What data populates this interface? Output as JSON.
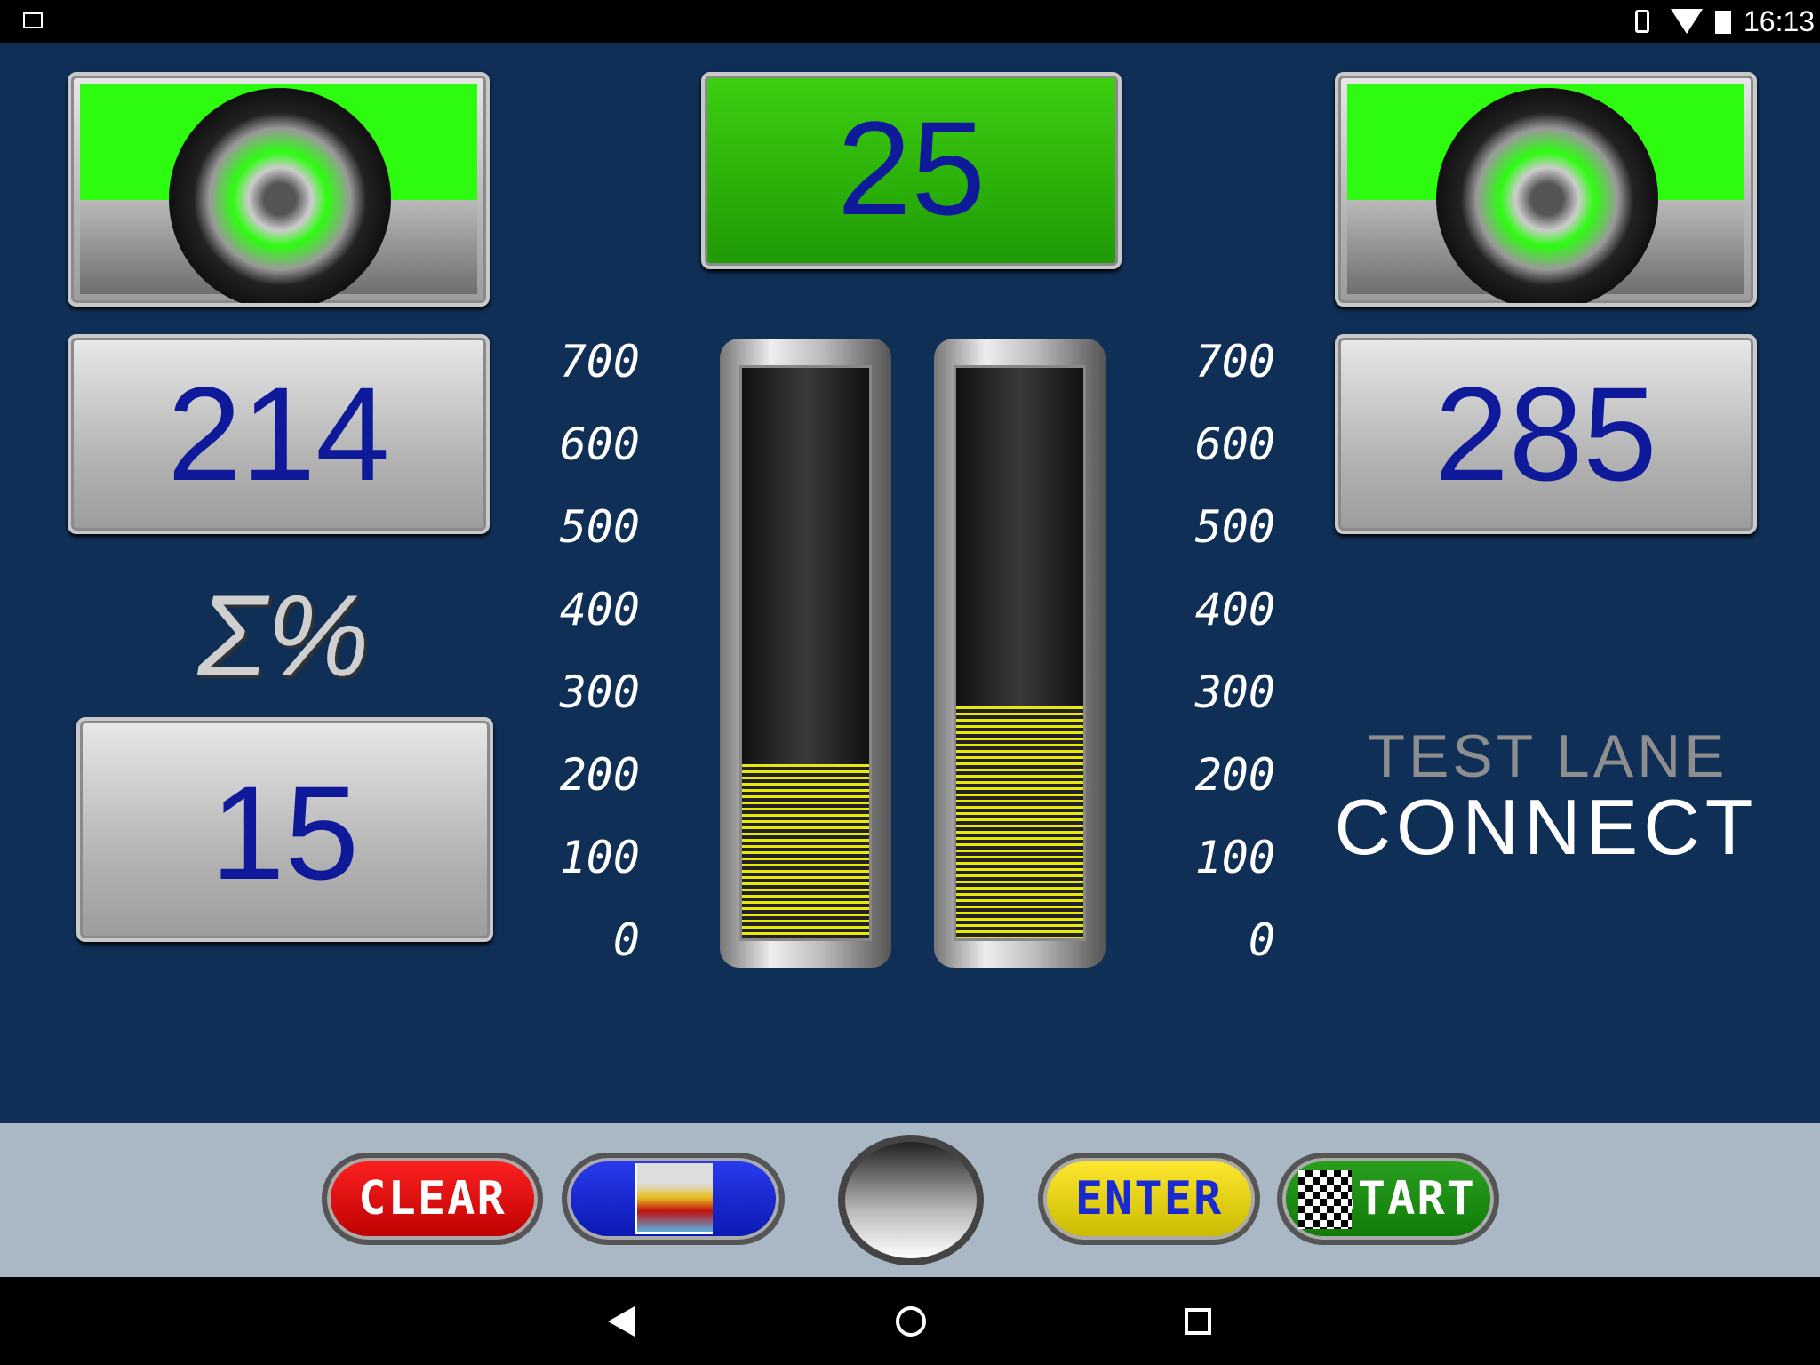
{
  "status_bar": {
    "time": "16:13",
    "icons": [
      "image-icon",
      "vibrate-icon",
      "wifi-icon",
      "battery-icon"
    ]
  },
  "center": {
    "value": "25"
  },
  "left": {
    "value": "214",
    "bar_value": 214
  },
  "right": {
    "value": "285",
    "bar_value": 285
  },
  "sum": {
    "symbol": "Σ%",
    "value": "15"
  },
  "scale": {
    "ticks": [
      "700",
      "600",
      "500",
      "400",
      "300",
      "200",
      "100",
      "0"
    ],
    "max": 700
  },
  "logo": {
    "line1": "TEST LANE",
    "line2": "CONNECT"
  },
  "buttons": {
    "clear": "CLEAR",
    "chart": "chart-icon",
    "enter": "ENTER",
    "start": "START"
  },
  "colors": {
    "background": "#0f2f56",
    "digits": "#0f1a9a",
    "green": "#2dfc10",
    "bar_fill": "#e8e80a"
  }
}
